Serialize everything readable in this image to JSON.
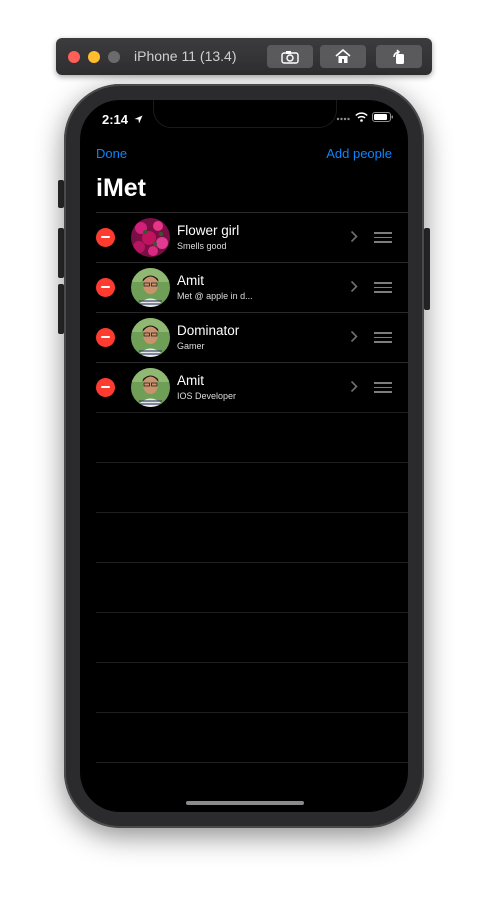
{
  "simulator": {
    "title": "iPhone 11 (13.4)"
  },
  "status_bar": {
    "time": "2:14"
  },
  "nav": {
    "left": "Done",
    "right": "Add people",
    "title": "iMet"
  },
  "people": [
    {
      "name": "Flower girl",
      "note": "Smells good",
      "avatar": "flower-photo"
    },
    {
      "name": "Amit",
      "note": "Met @ apple in d...",
      "avatar": "person-photo"
    },
    {
      "name": "Dominator",
      "note": "Gamer",
      "avatar": "person-photo"
    },
    {
      "name": "Amit",
      "note": "IOS Developer",
      "avatar": "person-photo"
    }
  ],
  "colors": {
    "accent": "#0a84ff",
    "delete": "#ff3b30",
    "background": "#000000"
  }
}
